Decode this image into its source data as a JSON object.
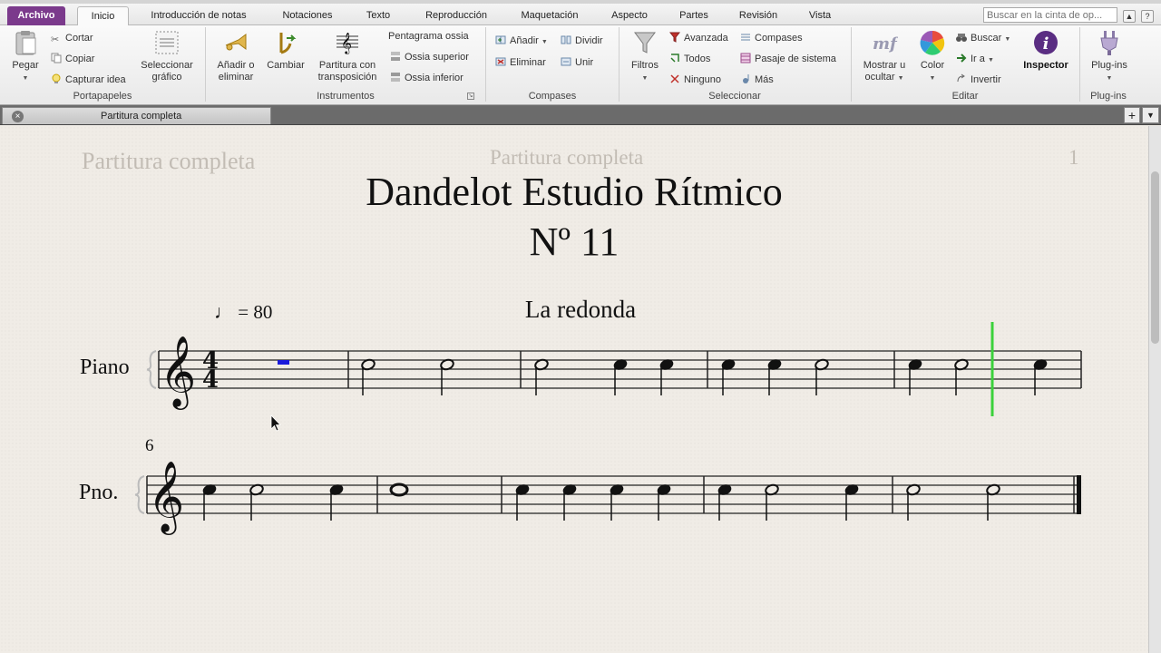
{
  "ribbon_tabs": [
    {
      "label": "Archivo"
    },
    {
      "label": "Inicio"
    },
    {
      "label": "Introducción de notas"
    },
    {
      "label": "Notaciones"
    },
    {
      "label": "Texto"
    },
    {
      "label": "Reproducción"
    },
    {
      "label": "Maquetación"
    },
    {
      "label": "Aspecto"
    },
    {
      "label": "Partes"
    },
    {
      "label": "Revisión"
    },
    {
      "label": "Vista"
    }
  ],
  "search": {
    "placeholder": "Buscar en la cinta de op..."
  },
  "window_buttons": {
    "collapse": "▲",
    "help": "?"
  },
  "groups": {
    "clipboard": {
      "label": "Portapapeles",
      "paste": "Pegar",
      "cut": "Cortar",
      "copy": "Copiar",
      "capture": "Capturar idea",
      "select_graphic": "Seleccionar gráfico"
    },
    "instruments": {
      "label": "Instrumentos",
      "add_remove": "Añadir o eliminar",
      "change": "Cambiar",
      "transposing": "Partitura con transposición",
      "ossia_staff": "Pentagrama ossia",
      "ossia_above": "Ossia superior",
      "ossia_below": "Ossia inferior"
    },
    "bars": {
      "label": "Compases",
      "add": "Añadir",
      "split": "Dividir",
      "delete": "Eliminar",
      "join": "Unir"
    },
    "select": {
      "label": "Seleccionar",
      "filters": "Filtros",
      "advanced": "Avanzada",
      "all": "Todos",
      "none": "Ninguno",
      "bars": "Compases",
      "system_passage": "Pasaje de sistema",
      "more": "Más"
    },
    "edit": {
      "label": "Editar",
      "show_hide": "Mostrar u ocultar",
      "color": "Color",
      "find": "Buscar",
      "goto": "Ir a",
      "invert": "Invertir",
      "inspector": "Inspector"
    },
    "plugins": {
      "label": "Plug-ins",
      "plugins": "Plug-ins"
    }
  },
  "document_tab": {
    "label": "Partitura completa",
    "close": "×",
    "add": "+",
    "menu": "▼"
  },
  "score": {
    "header_left": "Partitura completa",
    "header_center": "Partitura completa",
    "page_number": "1",
    "title": "Dandelot Estudio Rítmico",
    "number": "Nº 11",
    "subtitle": "La redonda",
    "tempo": "♩ = 80",
    "instrument_full": "Piano",
    "instrument_short": "Pno.",
    "system2_measure_number": "6",
    "time_signature": {
      "top": "4",
      "bottom": "4"
    }
  },
  "colors": {
    "file_tab": "#7b3a8c",
    "playback_line": "#3bd13b",
    "selection": "#1a1adb"
  }
}
